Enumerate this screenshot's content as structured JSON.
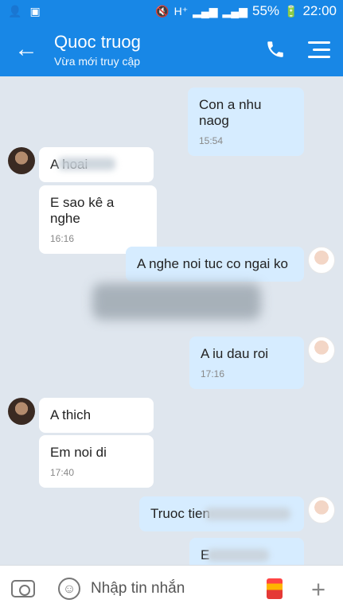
{
  "status_bar": {
    "left_icons": [
      "add-user-icon",
      "image-icon"
    ],
    "battery": "55%",
    "time": "22:00"
  },
  "header": {
    "title": "Quoc truog",
    "subtitle": "Vừa mới truy cập"
  },
  "messages": [
    {
      "side": "out",
      "text": "Con a nhu naog",
      "time": "15:54"
    },
    {
      "side": "in",
      "text": "A          hoai"
    },
    {
      "side": "in",
      "text": "E sao kê a nghe",
      "time": "16:16"
    },
    {
      "side": "out",
      "text": "A nghe noi tuc co ngai ko"
    },
    {
      "side": "out",
      "text": "A iu dau roi",
      "time": "17:16"
    },
    {
      "side": "in",
      "text": "A thich"
    },
    {
      "side": "in",
      "text": "Em noi di",
      "time": "17:40"
    },
    {
      "side": "out",
      "text": "Truoc tien"
    },
    {
      "side": "out",
      "text": "E"
    }
  ],
  "input": {
    "placeholder": "Nhập tin nhắn"
  }
}
